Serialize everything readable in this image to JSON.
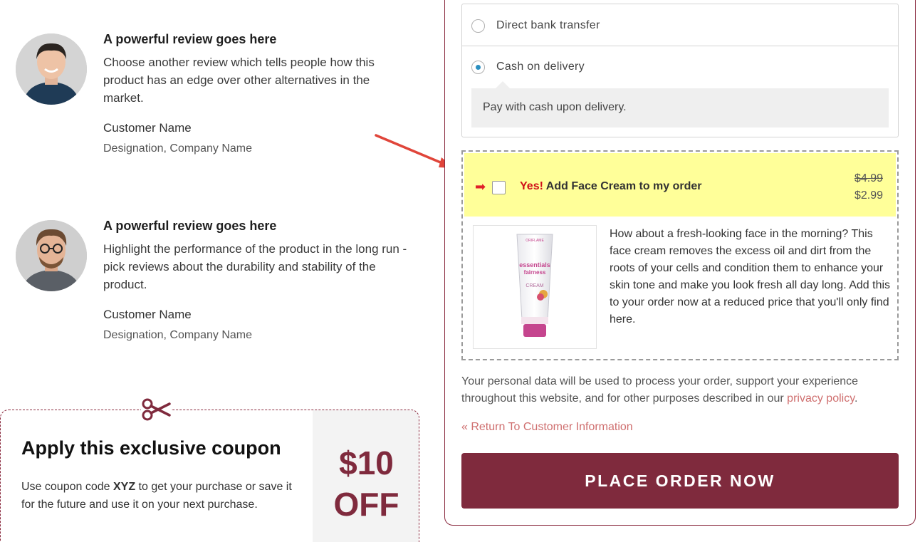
{
  "reviews": [
    {
      "title": "A powerful review goes here",
      "text": "Choose another review which tells people how this product has an edge over other alternatives in the market.",
      "name": "Customer Name",
      "designation": "Designation, Company Name"
    },
    {
      "title": "A powerful review goes here",
      "text": "Highlight the performance of the product in the long run - pick reviews about the durability and stability of the product.",
      "name": "Customer Name",
      "designation": "Designation, Company Name"
    }
  ],
  "coupon": {
    "title": "Apply this exclusive coupon",
    "text_before": "Use coupon code ",
    "code": "XYZ",
    "text_after": " to get your purchase or save it for the future and use it on your next purchase.",
    "amount": "$10",
    "off": "OFF",
    "icon": "scissors-icon",
    "accent_color": "#7f2a3d"
  },
  "payment": {
    "options": [
      {
        "label": "Direct bank transfer",
        "selected": false
      },
      {
        "label": "Cash on delivery",
        "selected": true
      }
    ],
    "description": "Pay with cash upon delivery."
  },
  "order_bump": {
    "yes": "Yes!",
    "title": " Add Face Cream to my order",
    "old_price": "$4.99",
    "new_price": "$2.99",
    "checked": false,
    "description": "How about a fresh-looking face in the morning? This face cream removes the excess oil and dirt from the roots of your cells and condition them to enhance your skin tone and make you look fresh all day long. Add this to your order now at a reduced price that you'll only find here.",
    "product_brand": "ORIFLAME",
    "product_name_line1": "essentials",
    "product_name_line2": "fairness",
    "product_label": "CREAM",
    "highlight_color": "#ffff99"
  },
  "privacy": {
    "text": "Your personal data will be used to process your order, support your experience throughout this website, and for other purposes described in our ",
    "link": "privacy policy",
    "end": "."
  },
  "return_link": "« Return To Customer Information",
  "place_order": "PLACE ORDER NOW"
}
